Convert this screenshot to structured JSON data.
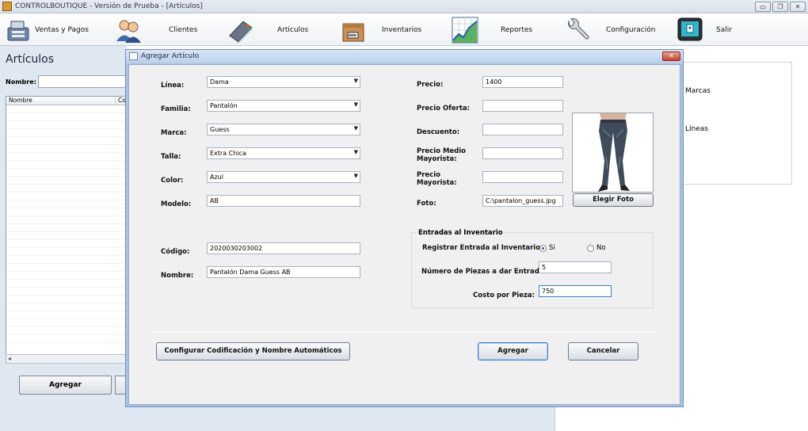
{
  "window": {
    "title": "CONTROLBOUTIQUE - Versión de Prueba - [Artículos]",
    "min_glyph": "▭",
    "restore_glyph": "❐",
    "close_glyph": "✕"
  },
  "toolbar": {
    "items": [
      {
        "label": "Ventas y Pagos",
        "icon": "cash-register-icon"
      },
      {
        "label": "Clientes",
        "icon": "people-icon"
      },
      {
        "label": "Artículos",
        "icon": "catalog-book-icon"
      },
      {
        "label": "Inventarios",
        "icon": "box-icon"
      },
      {
        "label": "Reportes",
        "icon": "chart-icon"
      },
      {
        "label": "Configuración",
        "icon": "wrench-icon"
      },
      {
        "label": "Salir",
        "icon": "exit-monitor-icon"
      }
    ]
  },
  "background": {
    "heading": "Artículos",
    "search_label": "Nombre:",
    "grid_columns": [
      "Nombre",
      "Co"
    ],
    "add_button": "Agregar",
    "scroll_left_glyph": "◂",
    "right_items": [
      "Marcas",
      "Líneas"
    ]
  },
  "dialog": {
    "title": "Agregar Artículo",
    "close_glyph": "✕",
    "left_fields": {
      "linea": {
        "label": "Línea:",
        "value": "Dama"
      },
      "familia": {
        "label": "Familia:",
        "value": "Pantalón"
      },
      "marca": {
        "label": "Marca:",
        "value": "Guess"
      },
      "talla": {
        "label": "Talla:",
        "value": "Extra Chica"
      },
      "color": {
        "label": "Color:",
        "value": "Azul"
      },
      "modelo": {
        "label": "Modelo:",
        "value": "AB"
      },
      "codigo": {
        "label": "Código:",
        "value": "2020030203002"
      },
      "nombre": {
        "label": "Nombre:",
        "value": "Pantalón Dama Guess AB"
      }
    },
    "right_fields": {
      "precio": {
        "label": "Precio:",
        "value": "1400"
      },
      "precio_oferta": {
        "label": "Precio Oferta:",
        "value": ""
      },
      "descuento": {
        "label": "Descuento:",
        "value": ""
      },
      "precio_medio_mayorista": {
        "label_line1": "Precio Medio",
        "label_line2": "Mayorista:",
        "value": ""
      },
      "precio_mayorista": {
        "label_line1": "Precio",
        "label_line2": "Mayorista:",
        "value": ""
      },
      "foto": {
        "label": "Foto:",
        "value": "C:\\pantalon_guess.jpg"
      }
    },
    "elegir_foto_button": "Elegir Foto",
    "inventory": {
      "group_label": "Entradas al Inventario",
      "registrar_label": "Registrar Entrada al Inventario:",
      "option_si": "Si",
      "option_no": "No",
      "selected": "Si",
      "piezas_label": "Número de Piezas a dar Entrada:",
      "piezas_value": "5",
      "costo_label": "Costo por Pieza:",
      "costo_value": "750"
    },
    "config_button": "Configurar Codificación y Nombre Automáticos",
    "agregar_button": "Agregar",
    "cancelar_button": "Cancelar"
  }
}
